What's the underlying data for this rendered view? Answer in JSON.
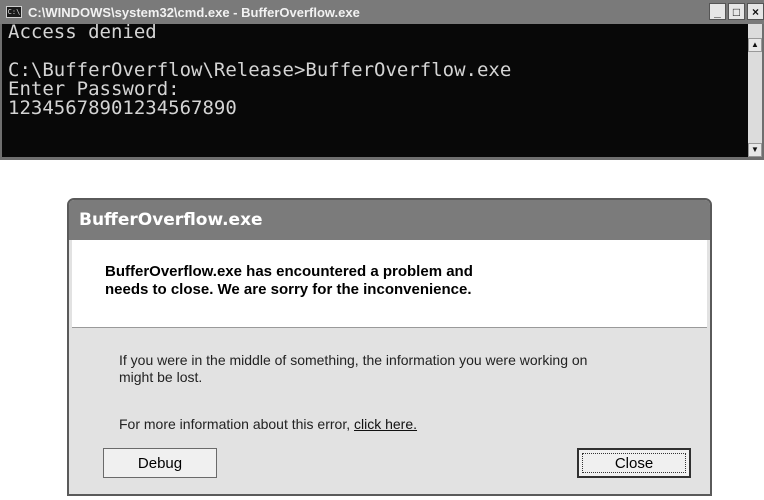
{
  "console": {
    "title": "C:\\WINDOWS\\system32\\cmd.exe - BufferOverflow.exe",
    "icon_label": "C:\\",
    "lines": [
      "Access denied",
      "",
      "C:\\BufferOverflow\\Release>BufferOverflow.exe",
      "Enter Password:",
      "12345678901234567890"
    ],
    "controls": {
      "minimize": "_",
      "maximize": "□",
      "close": "×"
    },
    "scroll_up": "▲",
    "scroll_down": "▼"
  },
  "dialog": {
    "title": "BufferOverflow.exe",
    "headline_line1": "BufferOverflow.exe has encountered a problem and",
    "headline_line2": "needs to close.  We are sorry for the inconvenience.",
    "message_line1": "If you were in the middle of something, the information you were working on",
    "message_line2": "might be lost.",
    "more_info_prefix": "For more information about this error, ",
    "more_info_link": "click here.",
    "debug_label": "Debug",
    "close_label": "Close"
  },
  "colors": {
    "console_background": "#080808",
    "console_text": "#d4d4d4",
    "titlebar": "#7a7a7a",
    "dialog_background": "#e2e2e2"
  }
}
